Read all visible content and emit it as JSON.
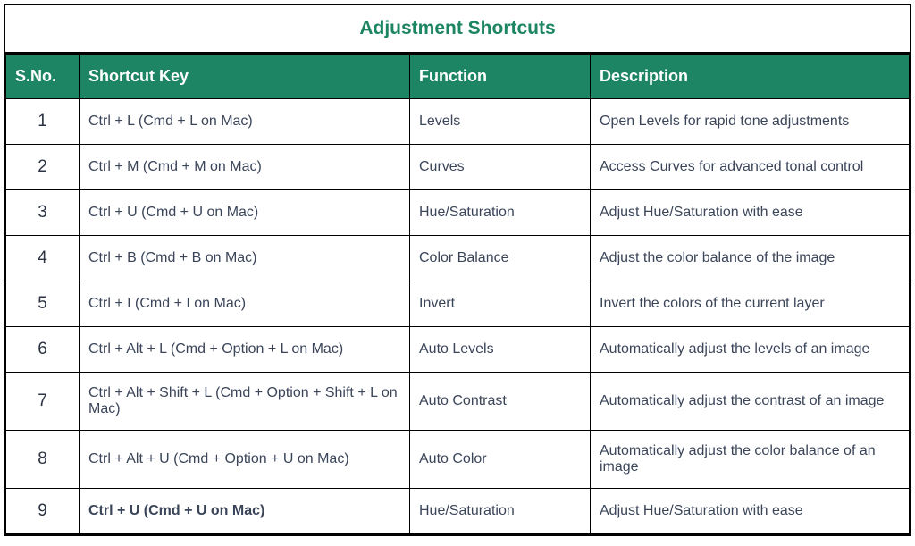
{
  "title": "Adjustment Shortcuts",
  "columns": {
    "sno": "S.No.",
    "shortcut": "Shortcut Key",
    "function": "Function",
    "description": "Description"
  },
  "rows": [
    {
      "sno": "1",
      "shortcut": "Ctrl + L (Cmd + L on Mac)",
      "function": "Levels",
      "description": "Open Levels for rapid tone adjustments",
      "bold": false
    },
    {
      "sno": "2",
      "shortcut": "Ctrl + M (Cmd + M on Mac)",
      "function": "Curves",
      "description": "Access Curves for advanced tonal control",
      "bold": false
    },
    {
      "sno": "3",
      "shortcut": "Ctrl + U (Cmd + U on Mac)",
      "function": "Hue/Saturation",
      "description": "Adjust Hue/Saturation with ease",
      "bold": false
    },
    {
      "sno": "4",
      "shortcut": "Ctrl + B (Cmd + B on Mac)",
      "function": "Color Balance",
      "description": "Adjust the color balance of the image",
      "bold": false
    },
    {
      "sno": "5",
      "shortcut": "Ctrl + I (Cmd + I on Mac)",
      "function": "Invert",
      "description": "Invert the colors of the current layer",
      "bold": false
    },
    {
      "sno": "6",
      "shortcut": "Ctrl + Alt + L (Cmd + Option + L on Mac)",
      "function": "Auto Levels",
      "description": "Automatically adjust the levels of an image",
      "bold": false
    },
    {
      "sno": "7",
      "shortcut": "Ctrl + Alt + Shift + L (Cmd + Option + Shift + L on Mac)",
      "function": "Auto Contrast",
      "description": "Automatically adjust the contrast of an image",
      "bold": false
    },
    {
      "sno": "8",
      "shortcut": "Ctrl + Alt + U (Cmd + Option + U on Mac)",
      "function": "Auto Color",
      "description": "Automatically adjust the color balance of an image",
      "bold": false
    },
    {
      "sno": "9",
      "shortcut": "Ctrl + U (Cmd + U on Mac)",
      "function": "Hue/Saturation",
      "description": "Adjust Hue/Saturation with ease",
      "bold": true
    }
  ]
}
